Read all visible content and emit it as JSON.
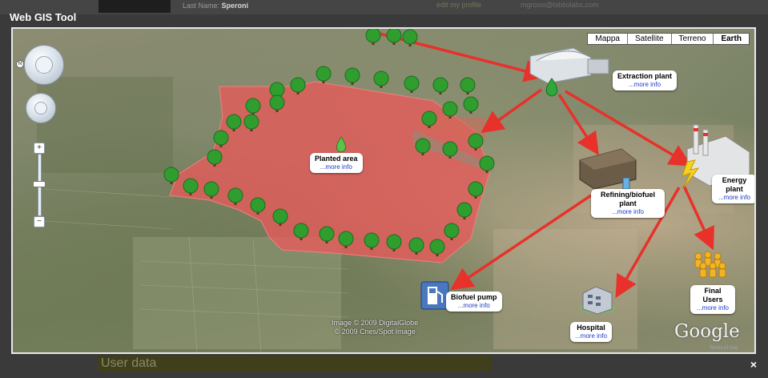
{
  "page": {
    "title": "Web GIS Tool",
    "close_symbol": "×",
    "background": {
      "last_name_label": "Last Name:",
      "last_name_value": "Speroni",
      "edit_link": "edit my profile",
      "email": "mgrossi@bibliolabs.com",
      "user_data_heading": "User data"
    }
  },
  "map": {
    "map_types": [
      "Mappa",
      "Satellite",
      "Terreno",
      "Earth"
    ],
    "active_map_type": "Earth",
    "controls": {
      "compass_letter": "N",
      "zoom_in": "+",
      "zoom_out": "−"
    },
    "labels": {
      "planted": {
        "name": "Planted area",
        "more": "...more info"
      },
      "extraction": {
        "name": "Extraction plant",
        "more": "...more info"
      },
      "energy": {
        "name": "Energy plant",
        "more": "...more info"
      },
      "refining": {
        "name": "Refining/biofuel plant",
        "more": "...more info"
      },
      "biofuel": {
        "name": "Biofuel pump",
        "more": "...more info"
      },
      "hospital": {
        "name": "Hospital",
        "more": "...more info"
      },
      "final": {
        "name": "Final Users",
        "more": "...more info"
      }
    },
    "attribution_1": "Image © 2009 DigitalGlobe",
    "attribution_2": "© 2009 Cnes/Spot Image",
    "google_logo": "Google",
    "terms_link": "Terms of Use",
    "colors": {
      "arrow": "#e8312a",
      "planted_fill": "#e85a5a",
      "tree": "#2f9e2f",
      "link": "#1a3cc8"
    }
  }
}
